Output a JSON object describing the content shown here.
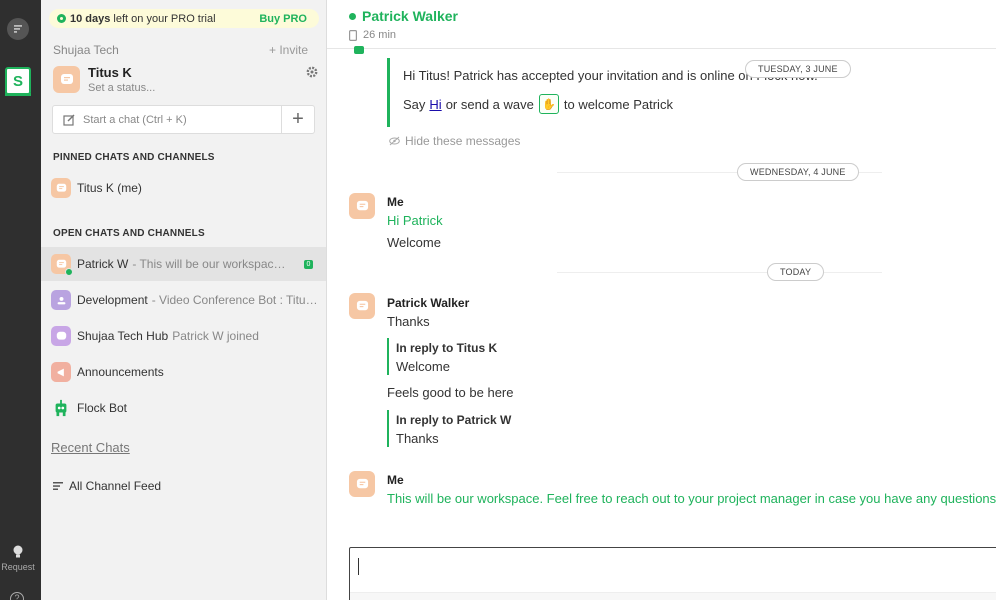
{
  "rail": {
    "team_initial": "S",
    "request_label": "Request",
    "help_label": "?"
  },
  "trial": {
    "days": "10 days",
    "suffix": " left on your PRO trial",
    "buy": "Buy PRO"
  },
  "team": {
    "name": "Shujaa Tech",
    "invite": "+ Invite"
  },
  "me": {
    "name": "Titus K",
    "status_placeholder": "Set a status..."
  },
  "start_chat": {
    "placeholder": "Start a chat (Ctrl + K)",
    "plus": "+"
  },
  "pinned": {
    "header": "PINNED CHATS AND CHANNELS",
    "items": [
      {
        "name": "Titus K (me)"
      }
    ]
  },
  "open": {
    "header": "OPEN CHATS AND CHANNELS",
    "items": [
      {
        "name": "Patrick W",
        "preview": "- This will be our workspace. Fe...",
        "unread": "0"
      },
      {
        "name": "Development",
        "preview": "- Video Conference Bot : Titus K..."
      },
      {
        "name": "Shujaa Tech Hub",
        "preview": "Patrick W joined"
      },
      {
        "name": "Announcements",
        "preview": ""
      },
      {
        "name": "Flock Bot",
        "preview": ""
      }
    ]
  },
  "recent_chats": "Recent Chats",
  "all_channel_feed": "All Channel Feed",
  "chat": {
    "name": "Patrick Walker",
    "sub": "26 min",
    "system": {
      "line1": "Hi Titus! Patrick has accepted your invitation and is online on Flock now.",
      "say": "Say",
      "hi": "Hi",
      "or_wave": "or send a wave",
      "welcome": "to welcome Patrick",
      "hide": "Hide these messages"
    },
    "dates": {
      "d1": "TUESDAY, 3 JUNE",
      "d2": "WEDNESDAY, 4 JUNE",
      "d3": "TODAY"
    },
    "messages": [
      {
        "sender": "Me",
        "lines": [
          "Hi Patrick",
          "Welcome"
        ]
      },
      {
        "sender": "Patrick Walker",
        "text1": "Thanks",
        "reply1_title": "In reply to Titus K",
        "reply1_text": "Welcome",
        "text2": "Feels good to be here",
        "reply2_title": "In reply to Patrick W",
        "reply2_text": "Thanks"
      },
      {
        "sender": "Me",
        "text": "This will be our workspace. Feel free to reach out to your project manager in case you have any questions"
      }
    ]
  },
  "colors": {
    "accent": "#1fb35c",
    "rail": "#2f2f2f",
    "sidebar": "#f2f2f2",
    "avatar": "#f6c7a4"
  }
}
